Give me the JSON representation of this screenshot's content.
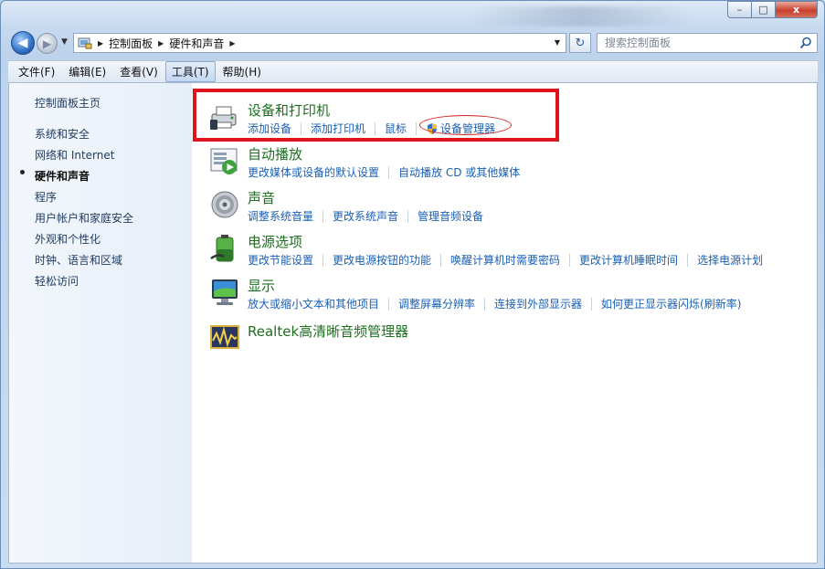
{
  "window": {
    "close": "x",
    "min": "–",
    "max": "□"
  },
  "nav": {
    "back": "◀",
    "forward": "▶",
    "history": "▼",
    "refresh": "↻"
  },
  "address": {
    "segments": [
      "控制面板",
      "硬件和声音"
    ]
  },
  "search": {
    "placeholder": "搜索控制面板"
  },
  "menus": [
    "文件(F)",
    "编辑(E)",
    "查看(V)",
    "工具(T)",
    "帮助(H)"
  ],
  "sidebar": {
    "home": "控制面板主页",
    "items": [
      "系统和安全",
      "网络和 Internet",
      "硬件和声音",
      "程序",
      "用户帐户和家庭安全",
      "外观和个性化",
      "时钟、语言和区域",
      "轻松访问"
    ]
  },
  "categories": [
    {
      "title": "设备和打印机",
      "icon": "printer-icon",
      "links": [
        "添加设备",
        "添加打印机",
        "鼠标",
        "设备管理器"
      ]
    },
    {
      "title": "自动播放",
      "icon": "autoplay-icon",
      "links": [
        "更改媒体或设备的默认设置",
        "自动播放 CD 或其他媒体"
      ]
    },
    {
      "title": "声音",
      "icon": "speaker-icon",
      "links": [
        "调整系统音量",
        "更改系统声音",
        "管理音频设备"
      ]
    },
    {
      "title": "电源选项",
      "icon": "battery-icon",
      "links": [
        "更改节能设置",
        "更改电源按钮的功能",
        "唤醒计算机时需要密码",
        "更改计算机睡眠时间",
        "选择电源计划"
      ]
    },
    {
      "title": "显示",
      "icon": "monitor-icon",
      "links": [
        "放大或缩小文本和其他项目",
        "调整屏幕分辨率",
        "连接到外部显示器",
        "如何更正显示器闪烁(刷新率)"
      ]
    },
    {
      "title": "Realtek高清晰音频管理器",
      "icon": "realtek-audio-icon",
      "links": []
    }
  ],
  "colors": {
    "link": "#1a5fb4",
    "category_title": "#1d6f1f",
    "highlight": "#e0141c"
  }
}
